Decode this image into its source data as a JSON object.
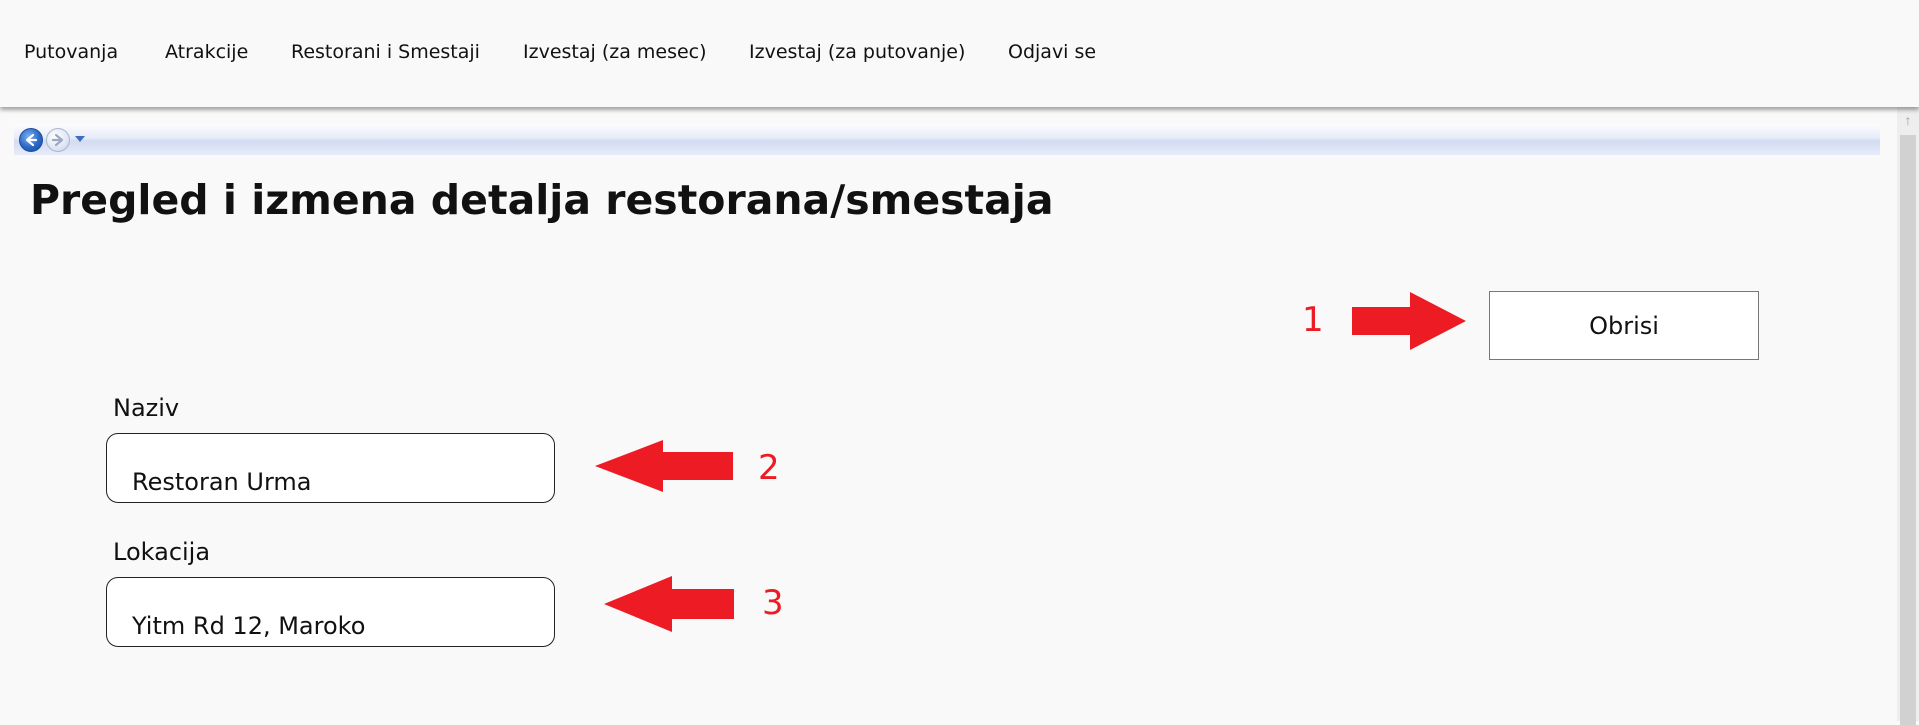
{
  "nav": {
    "items": [
      {
        "label": "Putovanja"
      },
      {
        "label": "Atrakcije"
      },
      {
        "label": "Restorani i Smestaji"
      },
      {
        "label": "Izvestaj (za mesec)"
      },
      {
        "label": "Izvestaj (za putovanje)"
      },
      {
        "label": "Odjavi se"
      }
    ]
  },
  "browser_toolbar": {
    "icons": [
      "back-arrow-icon",
      "forward-arrow-icon",
      "history-dropdown-icon"
    ]
  },
  "page": {
    "title": "Pregled i izmena detalja restorana/smestaja"
  },
  "actions": {
    "delete_label": "Obrisi"
  },
  "form": {
    "name_label": "Naziv",
    "name_value": "Restoran Urma",
    "location_label": "Lokacija",
    "location_value": "Yitm Rd 12, Maroko"
  },
  "annotations": {
    "items": [
      {
        "number": "1",
        "direction": "right"
      },
      {
        "number": "2",
        "direction": "left"
      },
      {
        "number": "3",
        "direction": "left"
      }
    ],
    "color": "#ed1c24"
  },
  "colors": {
    "background": "#f9f9fa",
    "annotation": "#ed1c24"
  }
}
